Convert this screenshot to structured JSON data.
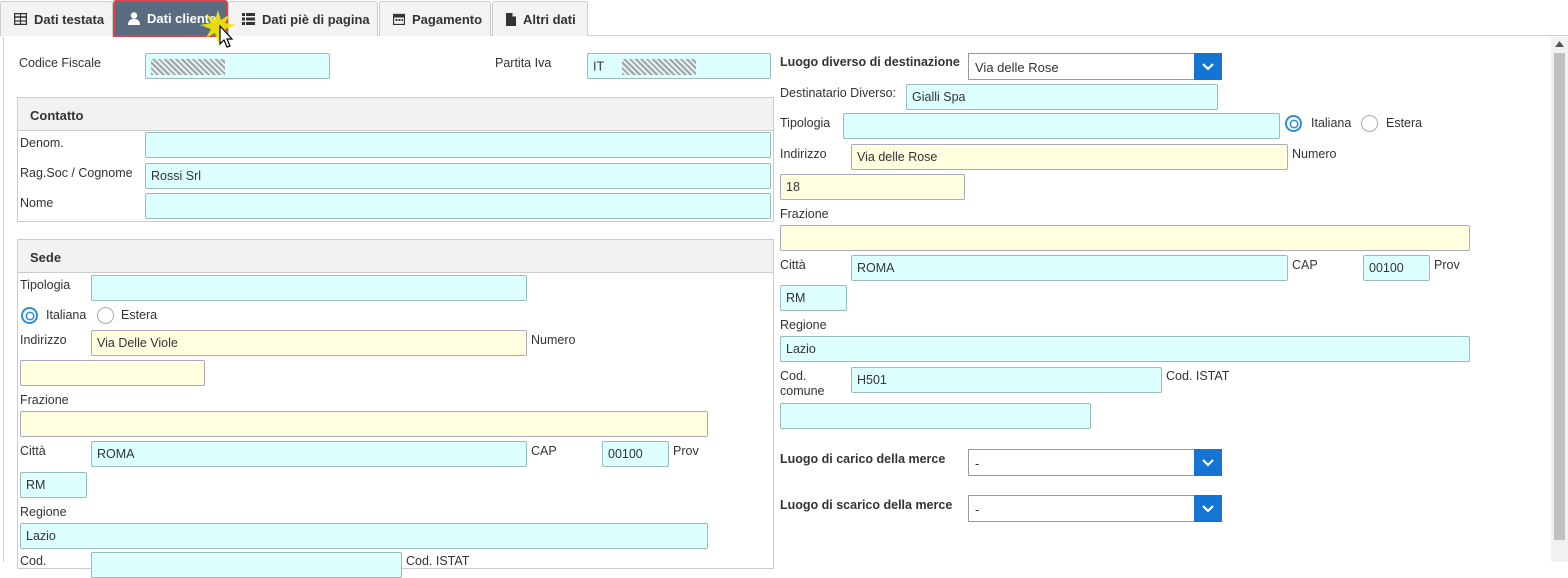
{
  "tabs": [
    {
      "label": "Dati testata",
      "icon": "table-icon"
    },
    {
      "label": "Dati cliente",
      "icon": "user-icon",
      "active": true
    },
    {
      "label": "Dati piè di pagina",
      "icon": "list-icon"
    },
    {
      "label": "Pagamento",
      "icon": "calendar-icon"
    },
    {
      "label": "Altri dati",
      "icon": "file-icon"
    }
  ],
  "top": {
    "codice_fiscale_label": "Codice Fiscale",
    "partita_iva_label": "Partita Iva",
    "partita_iva_prefix": "IT"
  },
  "contatto": {
    "title": "Contatto",
    "denom_label": "Denom.",
    "denom_value": "",
    "ragsoc_label": "Rag.Soc / Cognome",
    "ragsoc_value": "Rossi Srl",
    "nome_label": "Nome",
    "nome_value": ""
  },
  "sede": {
    "title": "Sede",
    "tipologia_label": "Tipologia",
    "italiana_label": "Italiana",
    "estera_label": "Estera",
    "indirizzo_label": "Indirizzo",
    "indirizzo_value": "Via Delle Viole",
    "numero_label": "Numero",
    "numero_value": "",
    "frazione_label": "Frazione",
    "citta_label": "Città",
    "citta_value": "ROMA",
    "cap_label": "CAP",
    "cap_value": "00100",
    "prov_label": "Prov",
    "prov_value": "RM",
    "regione_label": "Regione",
    "regione_value": "Lazio",
    "cod_label": "Cod.",
    "cod_istat_label": "Cod. ISTAT"
  },
  "destinazione": {
    "luogo_label": "Luogo diverso di destinazione",
    "luogo_value": "Via delle Rose",
    "destinatario_label": "Destinatario Diverso:",
    "destinatario_value": "Gialli Spa",
    "tipologia_label": "Tipologia",
    "italiana_label": "Italiana",
    "estera_label": "Estera",
    "indirizzo_label": "Indirizzo",
    "indirizzo_value": "Via delle Rose",
    "numero_label": "Numero",
    "numero_value": "18",
    "frazione_label": "Frazione",
    "citta_label": "Città",
    "citta_value": "ROMA",
    "cap_label": "CAP",
    "cap_value": "00100",
    "prov_label": "Prov",
    "prov_value": "RM",
    "regione_label": "Regione",
    "regione_value": "Lazio",
    "cod_comune_label_1": "Cod.",
    "cod_comune_label_2": "comune",
    "cod_comune_value": "H501",
    "cod_istat_label": "Cod. ISTAT",
    "cod_istat_value": "",
    "carico_label": "Luogo di carico della merce",
    "carico_value": "-",
    "scarico_label": "Luogo di scarico della merce",
    "scarico_value": "-"
  },
  "colors": {
    "input_cyan": "#ddffff",
    "input_yellow": "#ffffe0",
    "accent": "#1474d4",
    "active_tab": "#5a6d80"
  }
}
